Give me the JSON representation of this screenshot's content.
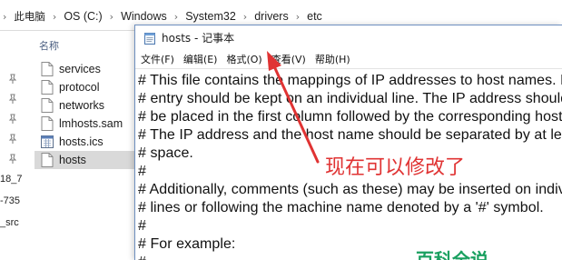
{
  "explorer": {
    "breadcrumb": [
      "此电脑",
      "OS (C:)",
      "Windows",
      "System32",
      "drivers",
      "etc"
    ],
    "column_header": "名称",
    "nav_fragments": [
      "18_7",
      "-735",
      "_src"
    ],
    "files": [
      {
        "name": "services",
        "icon": "document-icon"
      },
      {
        "name": "protocol",
        "icon": "document-icon"
      },
      {
        "name": "networks",
        "icon": "document-icon"
      },
      {
        "name": "lmhosts.sam",
        "icon": "document-icon"
      },
      {
        "name": "hosts.ics",
        "icon": "calendar-icon"
      },
      {
        "name": "hosts",
        "icon": "document-icon",
        "selected": true
      }
    ]
  },
  "notepad": {
    "title": "hosts - 记事本",
    "menu": [
      "文件(F)",
      "编辑(E)",
      "格式(O)",
      "查看(V)",
      "帮助(H)"
    ],
    "lines": [
      "# This file contains the mappings of IP addresses to host names. Each",
      "# entry should be kept on an individual line. The IP address should",
      "# be placed in the first column followed by the corresponding host name.",
      "# The IP address and the host name should be separated by at least one",
      "# space.",
      "#",
      "# Additionally, comments (such as these) may be inserted on individual",
      "# lines or following the machine name denoted by a '#' symbol.",
      "#",
      "# For example:",
      "#"
    ]
  },
  "annotation": {
    "text": "现在可以修改了",
    "color": "#e03333"
  },
  "watermark": {
    "text": "百科全说",
    "color": "#1aa060"
  }
}
